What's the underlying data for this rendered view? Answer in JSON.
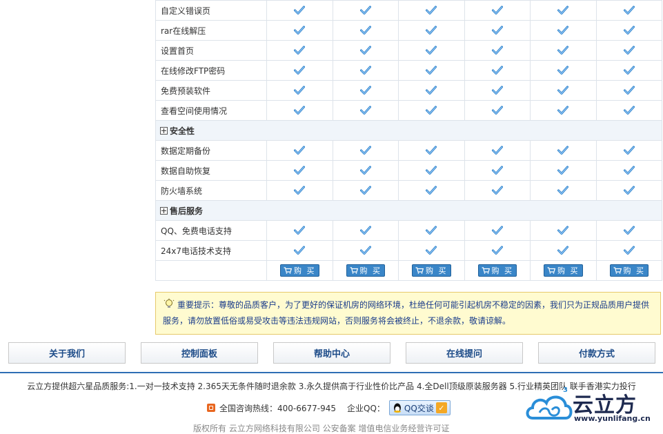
{
  "table": {
    "rows": [
      {
        "type": "feature",
        "label": "自定义错误页"
      },
      {
        "type": "feature",
        "label": "rar在线解压"
      },
      {
        "type": "feature",
        "label": "设置首页"
      },
      {
        "type": "feature",
        "label": "在线修改FTP密码"
      },
      {
        "type": "feature",
        "label": "免费预装软件"
      },
      {
        "type": "feature",
        "label": "查看空间使用情况"
      },
      {
        "type": "section",
        "label": "安全性"
      },
      {
        "type": "feature",
        "label": "数据定期备份"
      },
      {
        "type": "feature",
        "label": "数据自助恢复"
      },
      {
        "type": "feature",
        "label": "防火墙系统"
      },
      {
        "type": "section",
        "label": "售后服务"
      },
      {
        "type": "feature",
        "label": "QQ、免费电话支持"
      },
      {
        "type": "feature",
        "label": "24x7电话技术支持"
      },
      {
        "type": "buy",
        "label": ""
      }
    ],
    "plan_count": 6,
    "buy_label": "购 买",
    "check_icon": "checkmark-icon",
    "check_color": "#2a7fc9"
  },
  "notice": {
    "text": "重要提示：尊敬的品质客户，为了更好的保证机房的网络环境，杜绝任何可能引起机房不稳定的因素，我们只为正规品质用户提供服务，请勿放置低俗或易受攻击等违法违规网站，否则服务将会被终止，不退余款，敬请谅解。",
    "icon": "lightbulb-icon"
  },
  "nav": [
    "关于我们",
    "控制面板",
    "帮助中心",
    "在线提问",
    "付款方式"
  ],
  "footer": {
    "services": "云立方提供超六星品质服务:1.一对一技术支持 2.365天无条件随时退余款 3.永久提供高于行业性价比产品 4.全Dell顶级原装服务器 5.行业精英团队 联手香港实力投行",
    "hotline_label": "全国咨询热线：400-6677-945",
    "qq_label": "企业QQ：",
    "qq_button": "QQ交谈",
    "partial_line": "版权所有 云立方网络科技有限公司 公安备案 增值电信业务经营许可证"
  },
  "logo": {
    "brand": "云立方",
    "url": "www.yunlifang.cn",
    "superscript": "3"
  },
  "colors": {
    "accent": "#2e6eb5",
    "nav_text": "#1c4b88",
    "notice_bg": "#fffbd0",
    "notice_text": "#1a3c8a"
  }
}
